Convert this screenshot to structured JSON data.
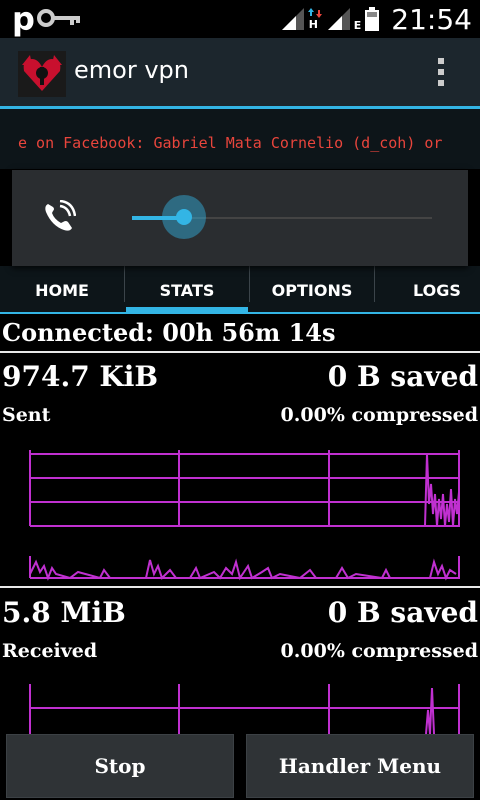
{
  "status_bar": {
    "left_letter": "p",
    "icons": [
      "key-icon",
      "signal-icon",
      "data-h-plus-icon",
      "signal-icon",
      "data-e-icon",
      "battery-icon"
    ],
    "h_label": "H",
    "e_label": "E",
    "time": "21:54"
  },
  "app_bar": {
    "title": "emor vpn",
    "logo_icon": "app-logo-icon",
    "menu_icon": "overflow-menu-icon"
  },
  "ticker": {
    "text": "e on Facebook: Gabriel Mata Cornelio (d_coh) or"
  },
  "volume_popup": {
    "icon": "phone-ring-icon",
    "level": 0.1
  },
  "tabs": [
    {
      "label": "HOME"
    },
    {
      "label": "STATS",
      "selected": true
    },
    {
      "label": "OPTIONS"
    },
    {
      "label": "LOGS"
    }
  ],
  "stats": {
    "connected": "Connected: 00h 56m 14s",
    "sent": {
      "amount": "974.7 KiB",
      "label": "Sent",
      "saved": "0 B saved",
      "compressed": "0.00% compressed"
    },
    "received": {
      "amount": "5.8 MiB",
      "label": "Received",
      "saved": "0 B saved",
      "compressed": "0.00% compressed"
    }
  },
  "buttons": {
    "stop": "Stop",
    "handler_menu": "Handler Menu"
  },
  "colors": {
    "accent": "#33b5e5",
    "graph": "#c030d0",
    "ticker_text": "#e8453c"
  }
}
